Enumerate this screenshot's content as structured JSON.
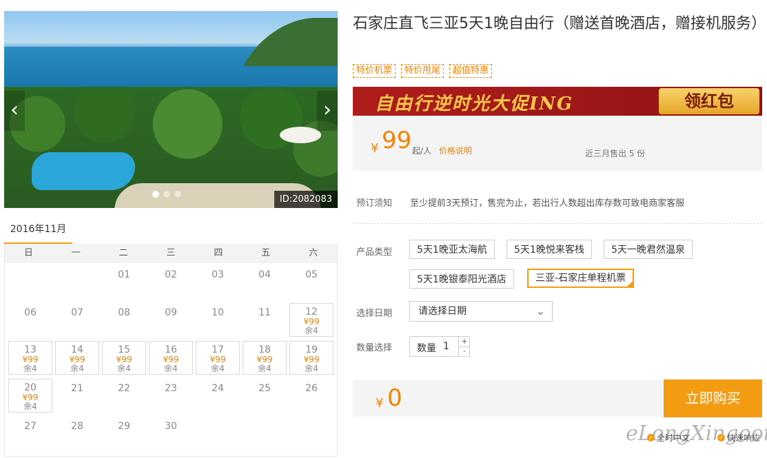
{
  "gallery": {
    "prev": "‹",
    "next": "›",
    "id_label": "ID:2082083",
    "dot_count": 3,
    "active_dot": 0
  },
  "calendar": {
    "month": "2016年11月",
    "weekdays": [
      "日",
      "一",
      "二",
      "三",
      "四",
      "五",
      "六"
    ],
    "cells": [
      {
        "day": ""
      },
      {
        "day": ""
      },
      {
        "day": "01"
      },
      {
        "day": "02"
      },
      {
        "day": "03"
      },
      {
        "day": "04"
      },
      {
        "day": "05"
      },
      {
        "day": "06"
      },
      {
        "day": "07"
      },
      {
        "day": "08"
      },
      {
        "day": "09"
      },
      {
        "day": "10"
      },
      {
        "day": "11"
      },
      {
        "day": "12",
        "price": "¥99",
        "remain": "余4"
      },
      {
        "day": "13",
        "price": "¥99",
        "remain": "余4"
      },
      {
        "day": "14",
        "price": "¥99",
        "remain": "余4"
      },
      {
        "day": "15",
        "price": "¥99",
        "remain": "余4"
      },
      {
        "day": "16",
        "price": "¥99",
        "remain": "余4"
      },
      {
        "day": "17",
        "price": "¥99",
        "remain": "余4"
      },
      {
        "day": "18",
        "price": "¥99",
        "remain": "余4"
      },
      {
        "day": "19",
        "price": "¥99",
        "remain": "余4"
      },
      {
        "day": "20",
        "price": "¥99",
        "remain": "余4"
      },
      {
        "day": "21"
      },
      {
        "day": "22"
      },
      {
        "day": "23"
      },
      {
        "day": "24"
      },
      {
        "day": "25"
      },
      {
        "day": "26"
      },
      {
        "day": "27"
      },
      {
        "day": "28"
      },
      {
        "day": "29"
      },
      {
        "day": "30"
      },
      {
        "day": ""
      },
      {
        "day": ""
      },
      {
        "day": ""
      }
    ]
  },
  "product": {
    "title": "石家庄直飞三亚5天1晚自由行（赠送首晚酒店，赠接机服务）",
    "tags": [
      "特价机票",
      "特价甩尾",
      "超值特惠"
    ],
    "banner_text": "自由行逆时光大促ING",
    "banner_button": "领红包",
    "price_currency": "¥",
    "price": "99",
    "price_unit": "起/人",
    "price_explain": "价格说明",
    "sold": "近三月售出 5 份"
  },
  "booking": {
    "notice_label": "预订须知",
    "notice_text": "至少提前3天预订，售完为止，若出行人数超出库存数可致电商家客服",
    "type_label": "产品类型",
    "types": [
      "5天1晚亚太海航",
      "5天1晚悦来客栈",
      "5天一晚君然温泉",
      "5天1晚银泰阳光酒店",
      "三亚-石家庄单程机票"
    ],
    "selected_type": 4,
    "date_label": "选择日期",
    "date_placeholder": "请选择日期",
    "qty_label": "数量选择",
    "qty_inner_label": "数量",
    "qty_value": "1",
    "qty_plus": "+",
    "qty_minus": "-",
    "total_currency": "¥",
    "total": "0",
    "buy_button": "立即购买",
    "services": [
      "全时中文",
      "快速响应"
    ]
  },
  "watermark": "eLongXingoot",
  "colors": {
    "accent": "#f39c12",
    "price": "#f08300",
    "banner": "#a8191a"
  }
}
